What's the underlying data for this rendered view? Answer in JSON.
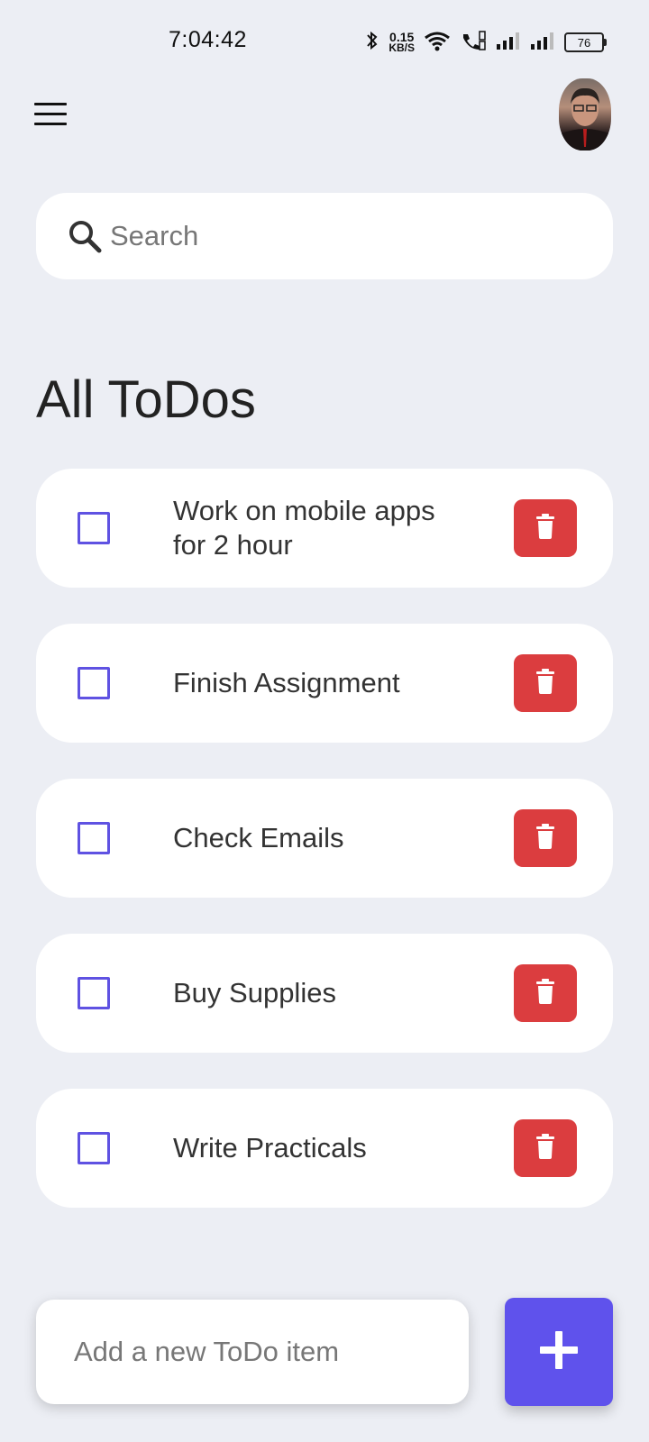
{
  "status_bar": {
    "time": "7:04:42",
    "network_speed_value": "0.15",
    "network_speed_unit": "KB/S",
    "battery_level": "76",
    "icons": [
      "bluetooth-icon",
      "wifi-icon",
      "volte-call-icon",
      "signal-icon",
      "signal-icon"
    ]
  },
  "header": {
    "menu_icon": "hamburger-menu-icon",
    "avatar": "profile-avatar"
  },
  "search": {
    "icon": "search-icon",
    "placeholder": "Search",
    "value": ""
  },
  "main": {
    "title": "All ToDos",
    "todos": [
      {
        "text": "Work on mobile apps for 2 hour",
        "done": false
      },
      {
        "text": "Finish Assignment",
        "done": false
      },
      {
        "text": "Check Emails",
        "done": false
      },
      {
        "text": "Buy Supplies",
        "done": false
      },
      {
        "text": "Write Practicals",
        "done": false
      }
    ]
  },
  "bottom": {
    "add_placeholder": "Add a new ToDo item",
    "add_value": "",
    "add_button_icon": "plus-icon"
  },
  "colors": {
    "background": "#eceef4",
    "accent": "#5f52ec",
    "delete": "#db3d3f",
    "checkbox_border": "#5f52e2"
  }
}
